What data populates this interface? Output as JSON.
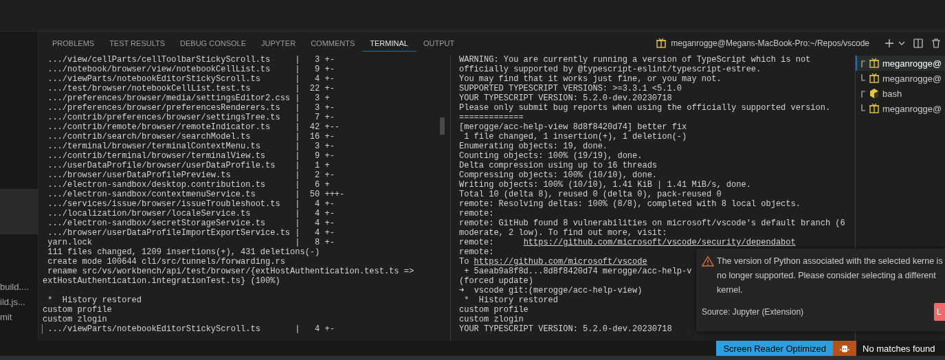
{
  "sidebar": {
    "items": [
      {
        "label": "build....",
        "selected": false
      },
      {
        "label": "ild.js...",
        "selected": false
      },
      {
        "label": "mit",
        "selected": false
      }
    ],
    "highlight": true
  },
  "panel": {
    "tabs": [
      {
        "label": "PROBLEMS",
        "selected": false
      },
      {
        "label": "TEST RESULTS",
        "selected": false
      },
      {
        "label": "DEBUG CONSOLE",
        "selected": false
      },
      {
        "label": "JUPYTER",
        "selected": false
      },
      {
        "label": "COMMENTS",
        "selected": false
      },
      {
        "label": "TERMINAL",
        "selected": true
      },
      {
        "label": "OUTPUT",
        "selected": false
      }
    ],
    "terminal_title": "meganrogge@Megans-MacBook-Pro:~/Repos/vscode"
  },
  "left_pane": {
    "output": [
      " .../view/cellParts/cellToolbarStickyScroll.ts     |   3 +-",
      " .../notebook/browser/view/notebookCellList.ts     |   9 +-",
      " .../viewParts/notebookEditorStickyScroll.ts       |   4 +-",
      " .../test/browser/notebookCellList.test.ts         |  22 +-",
      " .../preferences/browser/media/settingsEditor2.css |   3 +",
      " .../preferences/browser/preferencesRenderers.ts   |   3 +-",
      " .../contrib/preferences/browser/settingsTree.ts   |   7 +-",
      " .../contrib/remote/browser/remoteIndicator.ts     |  42 +--",
      " .../contrib/search/browser/searchModel.ts         |  16 +-",
      " .../terminal/browser/terminalContextMenu.ts       |   3 +-",
      " .../contrib/terminal/browser/terminalView.ts      |   9 +-",
      " .../userDataProfile/browser/userDataProfile.ts    |   1 +",
      " .../browser/userDataProfilePreview.ts             |   2 +-",
      " .../electron-sandbox/desktop.contribution.ts      |   6 +",
      " .../electron-sandbox/contextmenuService.ts        |  50 +++-",
      " .../services/issue/browser/issueTroubleshoot.ts   |   4 +-",
      " .../localization/browser/localeService.ts         |   4 +-",
      " .../electron-sandbox/secretStorageService.ts      |   4 +-",
      " .../browser/userDataProfileImportExportService.ts |   4 +-",
      " yarn.lock                                         |   8 +-",
      " 111 files changed, 1209 insertions(+), 431 deletions(-)",
      " create mode 100644 cli/src/tunnels/forwarding.rs",
      " rename src/vs/workbench/api/test/browser/{extHostAuthentication.test.ts =>",
      "extHostAuthentication.integrationTest.ts} (100%)"
    ],
    "session": [
      " *  History restored",
      "custom profile",
      "custom zlogin",
      " .../viewParts/notebookEditorStickyScroll.ts       |   4 +-"
    ],
    "cursor": true
  },
  "right_pane": {
    "lines": [
      "WARNING: You are currently running a version of TypeScript which is not",
      "officially supported by @typescript-eslint/typescript-estree.",
      "You may find that it works just fine, or you may not.",
      "SUPPORTED TYPESCRIPT VERSIONS: >=3.3.1 <5.1.0",
      "YOUR TYPESCRIPT VERSION: 5.2.0-dev.20230718",
      "Please only submit bug reports when using the officially supported version.",
      "=============",
      "[merogge/acc-help-view 8d8f8420d74] better fix",
      " 1 file changed, 1 insertion(+), 1 deletion(-)",
      "Enumerating objects: 19, done.",
      "Counting objects: 100% (19/19), done.",
      "Delta compression using up to 16 threads",
      "Compressing objects: 100% (10/10), done.",
      "Writing objects: 100% (10/10), 1.41 KiB | 1.41 MiB/s, done.",
      "Total 10 (delta 8), reused 0 (delta 0), pack-reused 0",
      "remote: Resolving deltas: 100% (8/8), completed with 8 local objects.",
      "remote:",
      "remote: GitHub found 8 vulnerabilities on microsoft/vscode's default branch (6",
      "moderate, 2 low). To find out more, visit:",
      {
        "prefix": "remote:      ",
        "link": "https://github.com/microsoft/vscode/security/dependabot"
      },
      "remote:",
      {
        "prefix": "To ",
        "link": "https://github.com/microsoft/vscode"
      },
      " + 5aeab9a8f8d...8d8f8420d74 merogge/acc-help-v",
      "(forced update)",
      "➜  vscode git:(merogge/acc-help-view)",
      " *  History restored",
      "custom profile",
      "custom zlogin",
      "YOUR TYPESCRIPT VERSION: 5.2.0-dev.20230718"
    ]
  },
  "terminal_list": [
    {
      "label": "meganrogge@",
      "kind": "group-start",
      "selected": true
    },
    {
      "label": "meganrogge@",
      "kind": "group-end",
      "selected": false
    },
    {
      "label": "bash",
      "kind": "group-start",
      "selected": false
    },
    {
      "label": "meganrogge@",
      "kind": "group-end",
      "selected": false
    }
  ],
  "notification": {
    "message": "The version of Python associated with the selected kerne is no longer supported. Please consider selecting a different kernel.",
    "source": "Source: Jupyter (Extension)",
    "button": "L"
  },
  "status_bar": {
    "screen_reader": "Screen Reader Optimized",
    "search_result": "No matches found"
  }
}
